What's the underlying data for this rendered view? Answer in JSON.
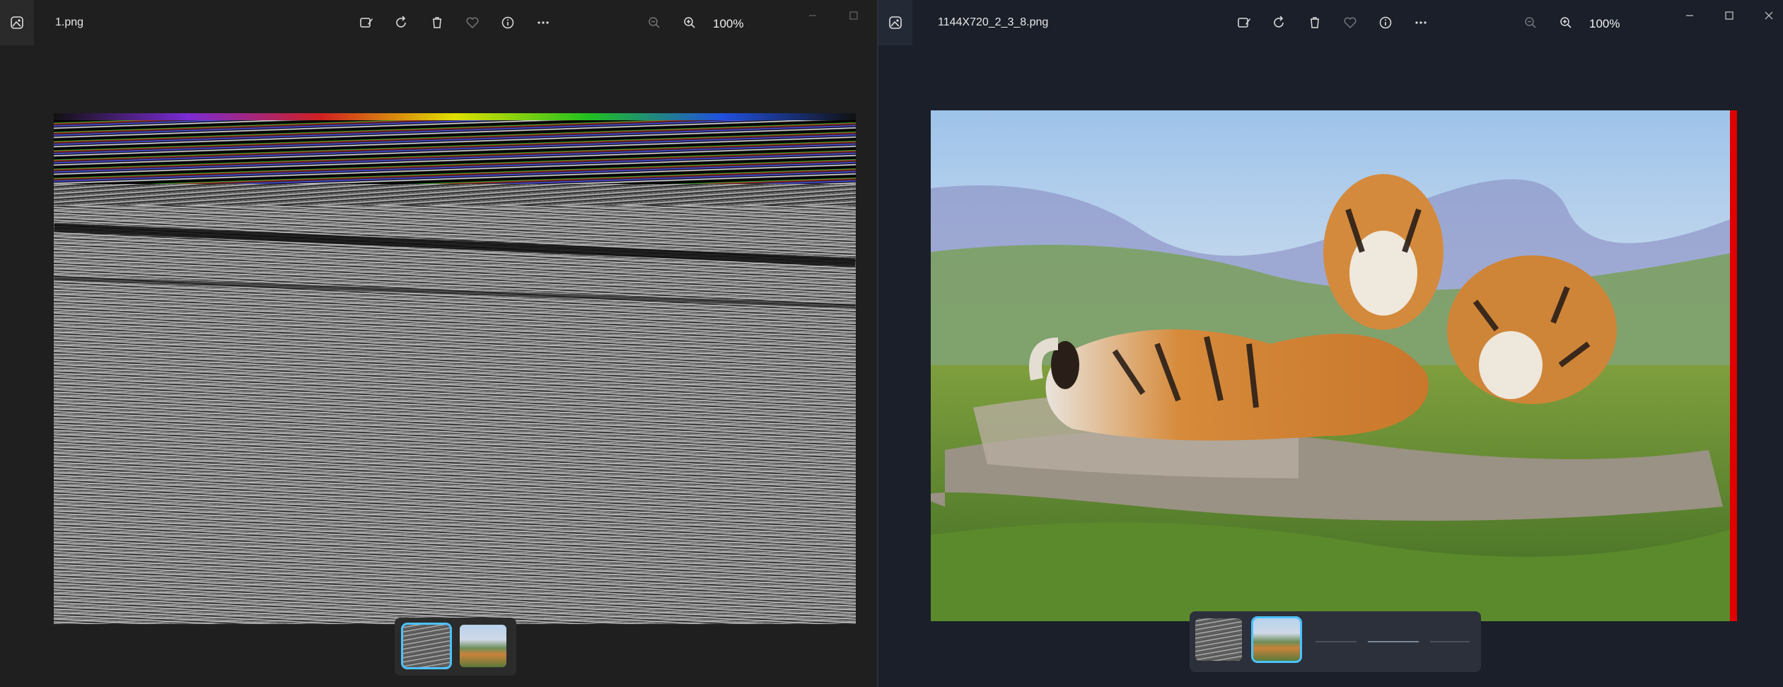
{
  "left_window": {
    "filename": "1.png",
    "zoom": "100%",
    "toolbar": {
      "edit_icon": "edit-image-icon",
      "rotate_icon": "rotate-icon",
      "delete_icon": "delete-icon",
      "favorite_icon": "heart-icon",
      "info_icon": "info-icon",
      "more_icon": "more-icon",
      "zoom_out_icon": "zoom-out-icon",
      "zoom_in_icon": "zoom-in-icon"
    },
    "filmstrip": {
      "selected_index": 0,
      "thumbnails": [
        "noise-thumbnail",
        "tiger-thumbnail"
      ]
    }
  },
  "right_window": {
    "filename": "1144X720_2_3_8.png",
    "zoom": "100%",
    "toolbar": {
      "edit_icon": "edit-image-icon",
      "rotate_icon": "rotate-icon",
      "delete_icon": "delete-icon",
      "favorite_icon": "heart-icon",
      "info_icon": "info-icon",
      "more_icon": "more-icon",
      "zoom_out_icon": "zoom-out-icon",
      "zoom_in_icon": "zoom-in-icon"
    },
    "filmstrip": {
      "selected_index": 1,
      "thumbnails": [
        "noise-thumbnail",
        "tiger-thumbnail"
      ]
    }
  },
  "colors": {
    "accent": "#4cc2ff",
    "left_bg": "#1f1f1f",
    "right_bg": "#1a1f29",
    "red_edge": "#e00000"
  }
}
